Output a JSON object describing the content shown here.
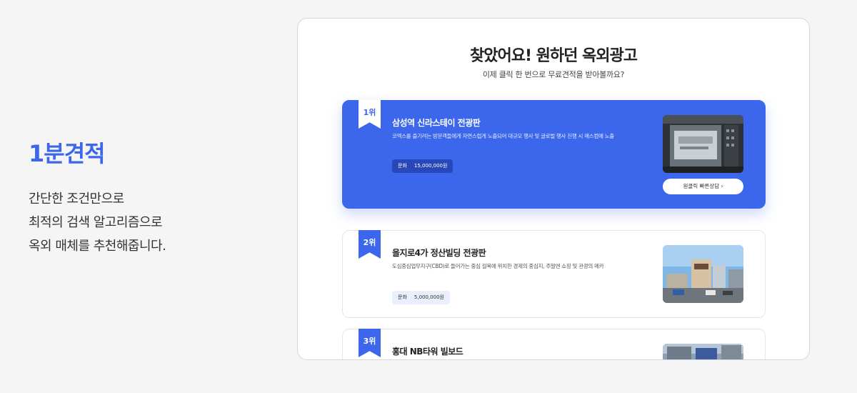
{
  "left": {
    "heading": "1분견적",
    "desc_lines": [
      "간단한 조건만으로",
      "최적의 검색 알고리즘으로",
      "옥외 매체를 추천해줍니다."
    ]
  },
  "panel": {
    "title": "찾았어요! 원하던 옥외광고",
    "subtitle": "이제 클릭 한 번으로 무료견적을 받아볼까요?"
  },
  "cards": [
    {
      "rank": "1위",
      "title": "삼성역 신라스테이 전광판",
      "desc": "코엑스를 즐기려는 방문객들에게 자연스럽게 노출되어 대규모 행사 및 글로벌 행사 진행 시 매스컴에 노출",
      "price_label": "문화",
      "price_value": "15,000,000원",
      "button": "원클릭 빠른상담 ›"
    },
    {
      "rank": "2위",
      "title": "을지로4가 정산빌딩 전광판",
      "desc": "도심중심업무지구(CBD)로 들어가는 중심 길목에 위치한 경제의 중심지, 주말엔 쇼핑 및 관광의 메카",
      "price_label": "문화",
      "price_value": "5,000,000원"
    },
    {
      "rank": "3위",
      "title": "홍대 NB타워 빌보드"
    }
  ],
  "colors": {
    "accent": "#3c66ec",
    "background": "#f5f5f5"
  },
  "icons": {
    "rank_badge": "ribbon-badge-icon",
    "button_arrow": "chevron-right-icon"
  }
}
